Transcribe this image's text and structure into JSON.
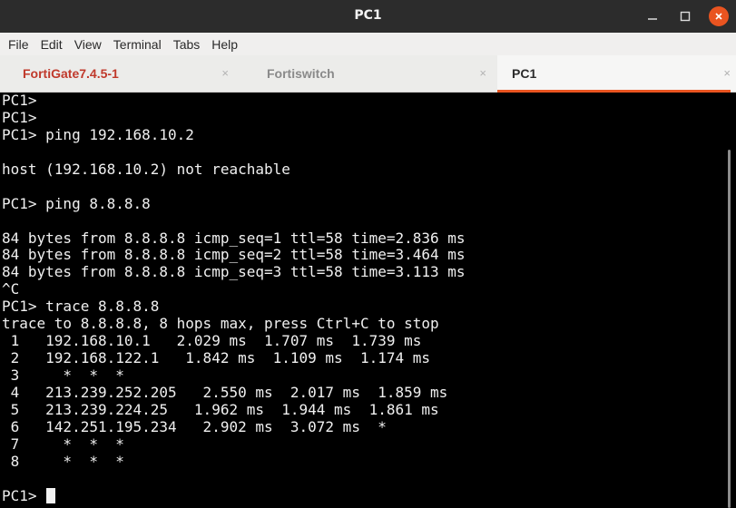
{
  "window": {
    "title": "PC1",
    "controls": {
      "minimize_icon": "minimize-icon",
      "maximize_icon": "maximize-icon",
      "close_icon": "close-icon",
      "close_color": "#e95420"
    }
  },
  "menu": {
    "items": [
      "File",
      "Edit",
      "View",
      "Terminal",
      "Tabs",
      "Help"
    ]
  },
  "tabs": [
    {
      "label": "FortiGate7.4.5-1",
      "close": "×",
      "active": false,
      "color": "#c0392b"
    },
    {
      "label": "Fortiswitch",
      "close": "×",
      "active": false,
      "color": "#8a8a8a"
    },
    {
      "label": "PC1",
      "close": "×",
      "active": true,
      "color": "#2b2b2b"
    }
  ],
  "accent_color": "#e95420",
  "terminal": {
    "lines": [
      "PC1>",
      "PC1>",
      "PC1> ping 192.168.10.2",
      "",
      "host (192.168.10.2) not reachable",
      "",
      "PC1> ping 8.8.8.8",
      "",
      "84 bytes from 8.8.8.8 icmp_seq=1 ttl=58 time=2.836 ms",
      "84 bytes from 8.8.8.8 icmp_seq=2 ttl=58 time=3.464 ms",
      "84 bytes from 8.8.8.8 icmp_seq=3 ttl=58 time=3.113 ms",
      "^C",
      "PC1> trace 8.8.8.8",
      "trace to 8.8.8.8, 8 hops max, press Ctrl+C to stop",
      " 1   192.168.10.1   2.029 ms  1.707 ms  1.739 ms",
      " 2   192.168.122.1   1.842 ms  1.109 ms  1.174 ms",
      " 3     *  *  *",
      " 4   213.239.252.205   2.550 ms  2.017 ms  1.859 ms",
      " 5   213.239.224.25   1.962 ms  1.944 ms  1.861 ms",
      " 6   142.251.195.234   2.902 ms  3.072 ms  *",
      " 7     *  *  *",
      " 8     *  *  *",
      "",
      "PC1> "
    ]
  }
}
